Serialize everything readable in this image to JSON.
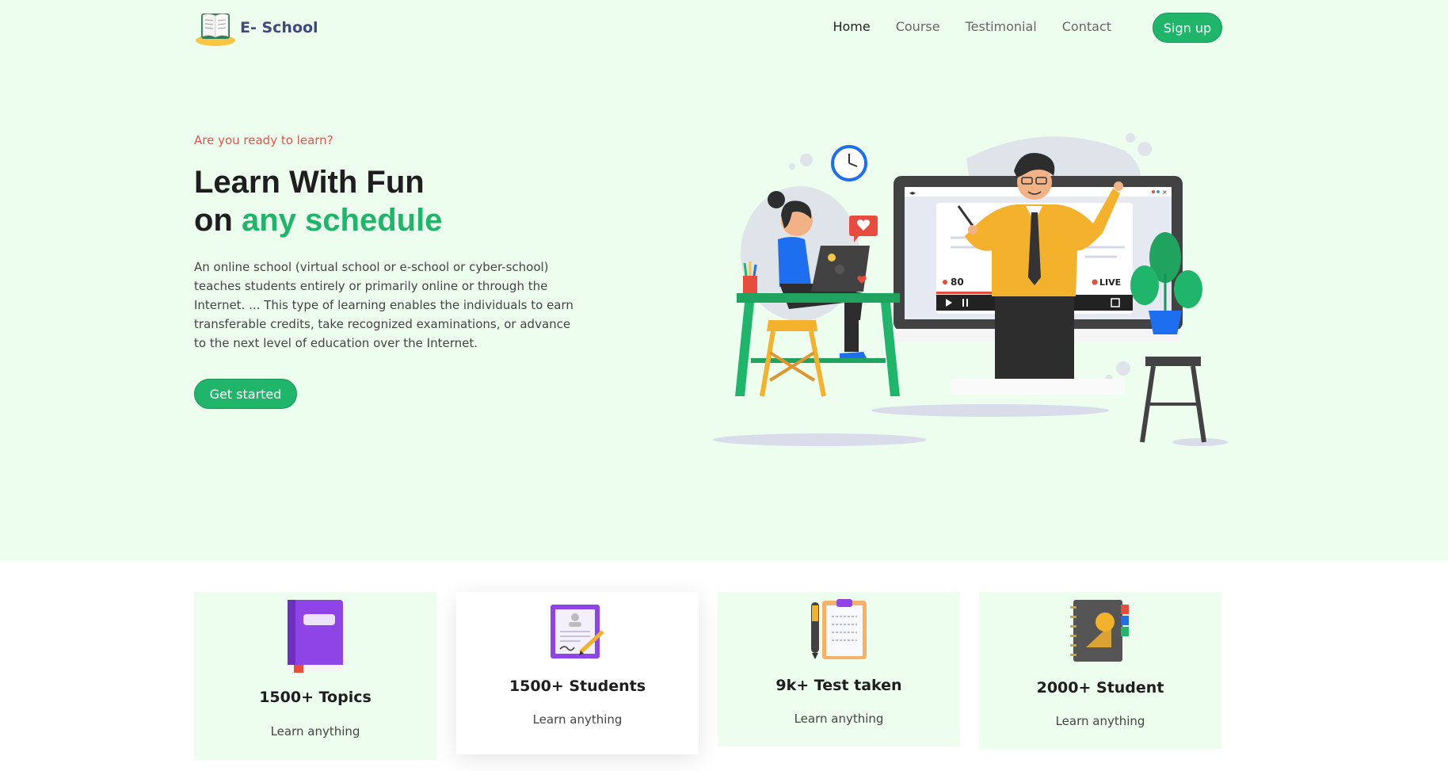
{
  "nav": {
    "brand": "E- School",
    "items": [
      {
        "label": "Home",
        "active": true
      },
      {
        "label": "Course",
        "active": false
      },
      {
        "label": "Testimonial",
        "active": false
      },
      {
        "label": "Contact",
        "active": false
      }
    ],
    "signup": "Sign up"
  },
  "hero": {
    "eyebrow": "Are you ready to learn?",
    "title_line1": "Learn With Fun",
    "title_on": "on ",
    "title_highlight": "any schedule",
    "description": "An online school (virtual school or e-school or cyber-school) teaches students entirely or primarily online or through the Internet. ... This type of learning enables the individuals to earn transferable credits, take recognized examinations, or advance to the next level of education over the Internet.",
    "cta": "Get started"
  },
  "illustration": {
    "viewer_count": "80",
    "live_label": "LIVE"
  },
  "stats": [
    {
      "title": "1500+ Topics",
      "subtitle": "Learn anything",
      "icon": "book-icon"
    },
    {
      "title": "1500+ Students",
      "subtitle": "Learn anything",
      "icon": "certificate-icon"
    },
    {
      "title": "9k+ Test taken",
      "subtitle": "Learn anything",
      "icon": "clipboard-icon"
    },
    {
      "title": "2000+ Student",
      "subtitle": "Learn anything",
      "icon": "notebook-icon"
    }
  ],
  "colors": {
    "accent": "#1fb56b",
    "hero_bg": "#edfdee",
    "eyebrow": "#e0554d",
    "brand_text": "#3f4a78"
  }
}
